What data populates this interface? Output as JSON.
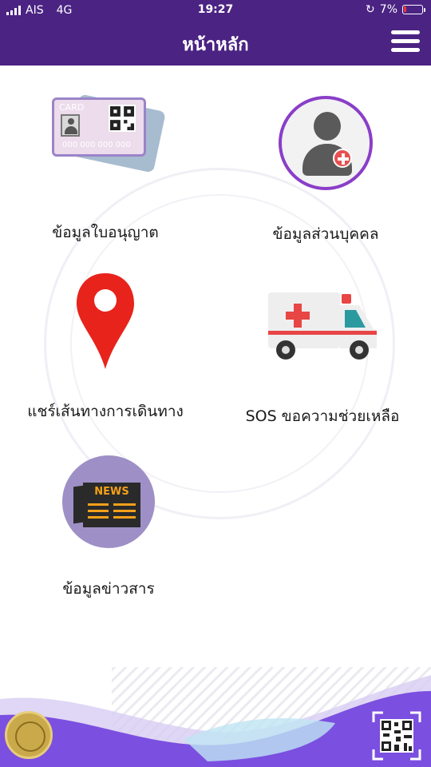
{
  "status_bar": {
    "carrier": "AIS",
    "network": "4G",
    "time": "19:27",
    "battery_percent": "7%"
  },
  "header": {
    "title": "หน้าหลัก",
    "menu_icon": "hamburger-menu-icon",
    "background": "#4b2383"
  },
  "menu_items": [
    {
      "label": "ข้อมูลใบอนุญาต",
      "icon": "license-card-icon",
      "card_text": "CARD",
      "card_number": "000 000 000 000"
    },
    {
      "label": "ข้อมูลส่วนบุคคล",
      "icon": "personal-info-icon"
    },
    {
      "label": "แชร์เส้นทางการเดินทาง",
      "icon": "location-pin-icon"
    },
    {
      "label": "SOS  ขอความช่วยเหลือ",
      "icon": "ambulance-icon"
    },
    {
      "label": "ข้อมูลข่าวสาร",
      "icon": "news-icon",
      "news_text": "NEWS"
    }
  ],
  "footer": {
    "left_icon": "department-seal-icon",
    "right_icon": "qr-scan-icon",
    "wave_color": "#7b4fe0"
  }
}
